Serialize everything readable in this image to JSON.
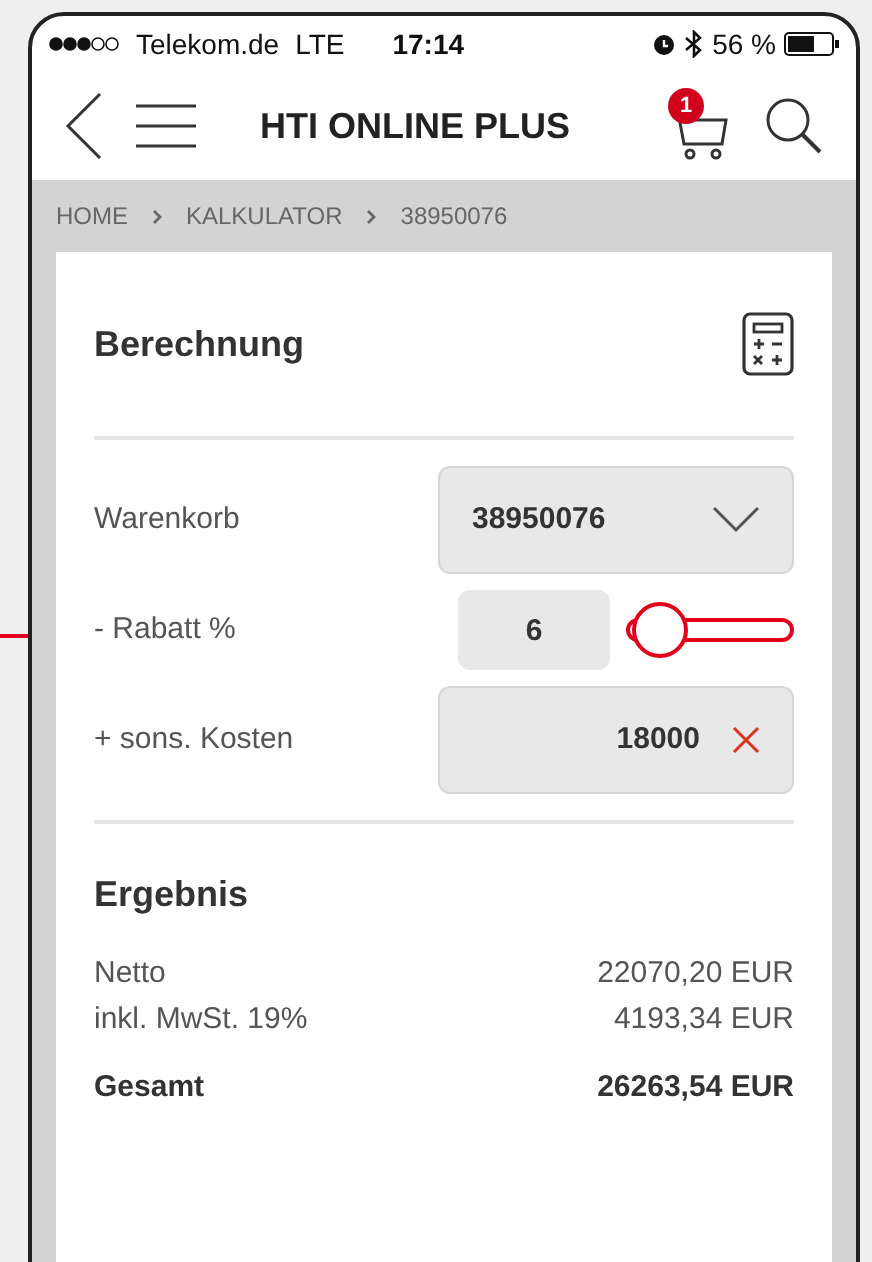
{
  "status_bar": {
    "carrier": "Telekom.de",
    "network": "LTE",
    "time": "17:14",
    "battery": "56 %"
  },
  "nav": {
    "title": "HTI ONLINE PLUS",
    "cart_count": "1"
  },
  "breadcrumb": [
    "HOME",
    "KALKULATOR",
    "38950076"
  ],
  "calculation": {
    "title": "Berechnung",
    "fields": [
      {
        "kind": "dropdown",
        "label": "Warenkorb",
        "value": "38950076"
      },
      {
        "kind": "slider",
        "label": "- Rabatt %",
        "value": "6",
        "level": 0.06
      },
      {
        "kind": "clearable",
        "label": "+ sons. Kosten",
        "value": "18000"
      }
    ]
  },
  "result": {
    "title": "Ergebnis",
    "rows": [
      {
        "kind": "line",
        "label": "Netto",
        "value": "22070,20 EUR"
      },
      {
        "kind": "line",
        "label": "inkl. MwSt. 19%",
        "value": "4193,34 EUR"
      },
      {
        "kind": "total",
        "label": "Gesamt",
        "value": "26263,54 EUR"
      }
    ]
  }
}
